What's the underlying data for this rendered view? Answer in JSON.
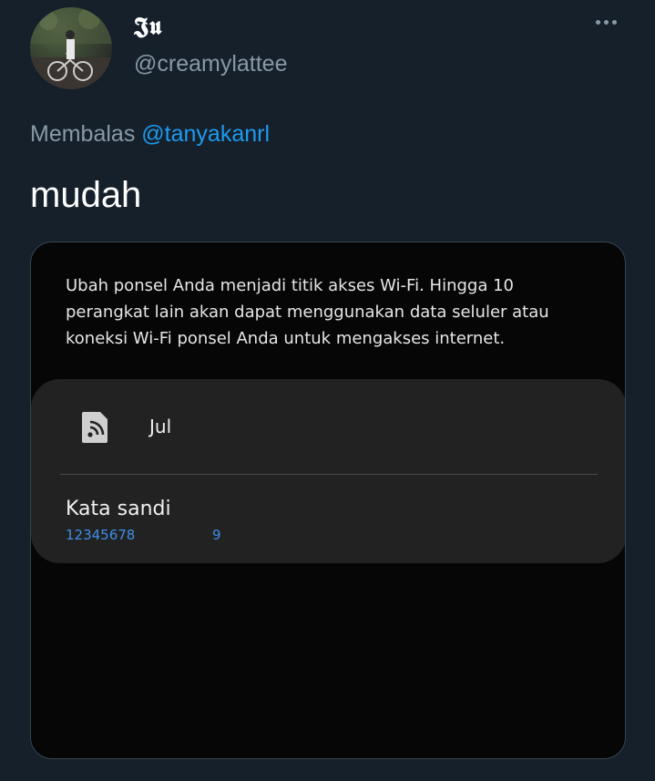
{
  "author": {
    "display_name": "𝕵𝖚",
    "handle": "@creamylattee"
  },
  "reply": {
    "prefix": "Membalas",
    "mention": "@tanyakanrl"
  },
  "tweet": {
    "text": "mudah"
  },
  "media": {
    "description": "Ubah ponsel Anda menjadi titik akses Wi-Fi. Hingga 10 perangkat lain akan dapat menggunakan data seluler atau koneksi Wi-Fi ponsel Anda untuk mengakses internet.",
    "network_icon": "hotspot-icon",
    "network_name": "Jul",
    "password_label": "Kata sandi",
    "password_value": "12345678",
    "password_extra": "9"
  },
  "colors": {
    "background": "#15202b",
    "secondary_text": "#8899a6",
    "link": "#1d9bf0",
    "password_blue": "#3e8ee8"
  }
}
